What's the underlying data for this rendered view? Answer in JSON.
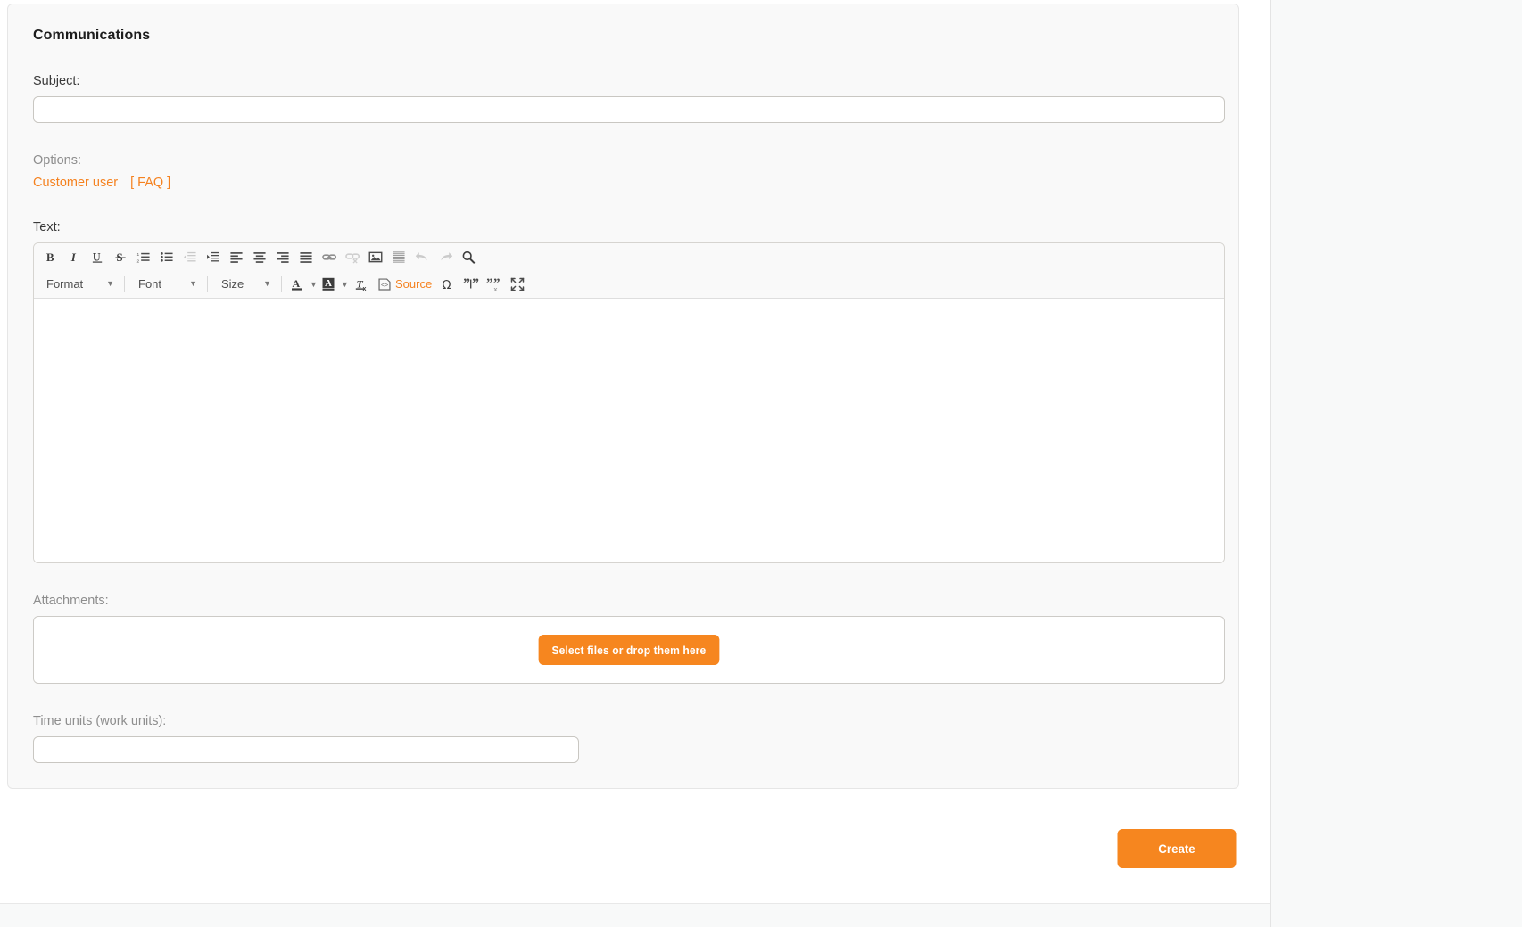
{
  "widget": {
    "title": "Communications"
  },
  "fields": {
    "subject": {
      "label": "Subject:",
      "value": "",
      "placeholder": ""
    },
    "options": {
      "label": "Options:",
      "links": [
        {
          "label": "Customer user"
        },
        {
          "label": "[ FAQ ]"
        }
      ]
    },
    "text": {
      "label": "Text:",
      "body_value": ""
    },
    "attachments": {
      "label": "Attachments:",
      "button_label": "Select files or drop them here"
    },
    "time_units": {
      "label": "Time units (work units):",
      "value": "",
      "placeholder": ""
    }
  },
  "editor": {
    "toolbar_row1": [
      {
        "name": "bold-icon",
        "label": "B",
        "disabled": false
      },
      {
        "name": "italic-icon",
        "label": "I",
        "disabled": false
      },
      {
        "name": "underline-icon",
        "label": "U",
        "disabled": false
      },
      {
        "name": "strikethrough-icon",
        "label": "S",
        "disabled": false
      },
      {
        "name": "numbered-list-icon",
        "label": "",
        "disabled": false
      },
      {
        "name": "bulleted-list-icon",
        "label": "",
        "disabled": false
      },
      {
        "name": "decrease-indent-icon",
        "label": "",
        "disabled": true
      },
      {
        "name": "increase-indent-icon",
        "label": "",
        "disabled": false
      },
      {
        "name": "align-left-icon",
        "label": "",
        "disabled": false
      },
      {
        "name": "align-center-icon",
        "label": "",
        "disabled": false
      },
      {
        "name": "align-right-icon",
        "label": "",
        "disabled": false
      },
      {
        "name": "align-justify-icon",
        "label": "",
        "disabled": false
      },
      {
        "name": "insert-link-icon",
        "label": "",
        "disabled": false
      },
      {
        "name": "unlink-icon",
        "label": "",
        "disabled": true
      },
      {
        "name": "insert-image-icon",
        "label": "",
        "disabled": false
      },
      {
        "name": "horizontal-rule-icon",
        "label": "",
        "disabled": false
      },
      {
        "name": "undo-icon",
        "label": "",
        "disabled": true
      },
      {
        "name": "redo-icon",
        "label": "",
        "disabled": true
      },
      {
        "name": "find-replace-icon",
        "label": "",
        "disabled": false
      }
    ],
    "combos": {
      "format": "Format",
      "font": "Font",
      "size": "Size"
    },
    "row2": {
      "text_color": "text-color-icon",
      "background_color": "background-color-icon",
      "remove_format": "remove-format-icon",
      "source_label": "Source",
      "special_char": "Ω",
      "blockquote": "blockquote-icon",
      "remove_quote": "remove-quote-icon",
      "maximize": "maximize-icon"
    }
  },
  "footer": {
    "create_label": "Create"
  },
  "colors": {
    "accent": "#f6861f",
    "link": "#f58220",
    "card_bg": "#f9f9f9",
    "border": "#e6e6e6",
    "muted_text": "#8e8e8e"
  }
}
